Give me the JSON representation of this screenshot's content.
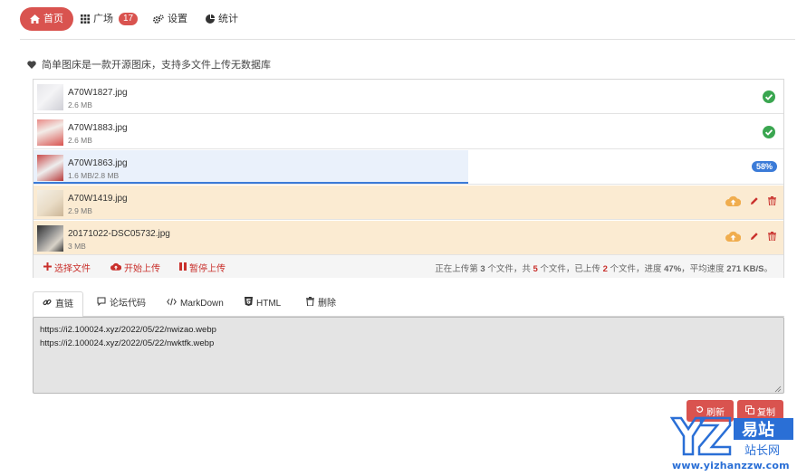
{
  "nav": {
    "home": "首页",
    "square": "广场",
    "square_badge": "17",
    "settings": "设置",
    "stats": "统计"
  },
  "tagline": "简单图床是一款开源图床，支持多文件上传无数据库",
  "files": [
    {
      "name": "A70W1827.jpg",
      "size": "2.6 MB",
      "status": "done"
    },
    {
      "name": "A70W1883.jpg",
      "size": "2.6 MB",
      "status": "done"
    },
    {
      "name": "A70W1863.jpg",
      "size": "1.6 MB/2.8 MB",
      "status": "uploading",
      "progress_label": "58%",
      "progress": 0.58
    },
    {
      "name": "A70W1419.jpg",
      "size": "2.9 MB",
      "status": "pending"
    },
    {
      "name": "20171022-DSC05732.jpg",
      "size": "3 MB",
      "status": "pending"
    }
  ],
  "toolbar": {
    "select": "选择文件",
    "start": "开始上传",
    "pause": "暂停上传",
    "status_prefix": "正在上传第 ",
    "current": "3",
    "status_mid1": " 个文件，共 ",
    "total": "5",
    "status_mid2": " 个文件，已上传 ",
    "uploaded": "2",
    "status_mid3": " 个文件，进度 ",
    "progress": "47%",
    "status_mid4": "，平均速度 ",
    "speed": "271 KB/S",
    "status_end": "。"
  },
  "tabs": [
    {
      "label": "直链",
      "icon": "link-icon"
    },
    {
      "label": "论坛代码",
      "icon": "comment-icon"
    },
    {
      "label": "MarkDown",
      "icon": "code-icon"
    },
    {
      "label": "HTML",
      "icon": "html5-icon"
    },
    {
      "label": "删除",
      "icon": "trash-icon"
    }
  ],
  "links": [
    "https://i2.100024.xyz/2022/05/22/nwizao.webp",
    "https://i2.100024.xyz/2022/05/22/nwktfk.webp"
  ],
  "buttons": {
    "refresh": "刷新",
    "copy": "复制"
  },
  "watermark": {
    "chars": "易站",
    "sub": "站长网",
    "url": "www.yizhanzzw.com"
  },
  "colors": {
    "accent": "#d9534f",
    "success": "#3aa650",
    "progress": "#3b7bd8",
    "pending_bg": "#fbebd2",
    "warn": "#f0ad4e"
  }
}
